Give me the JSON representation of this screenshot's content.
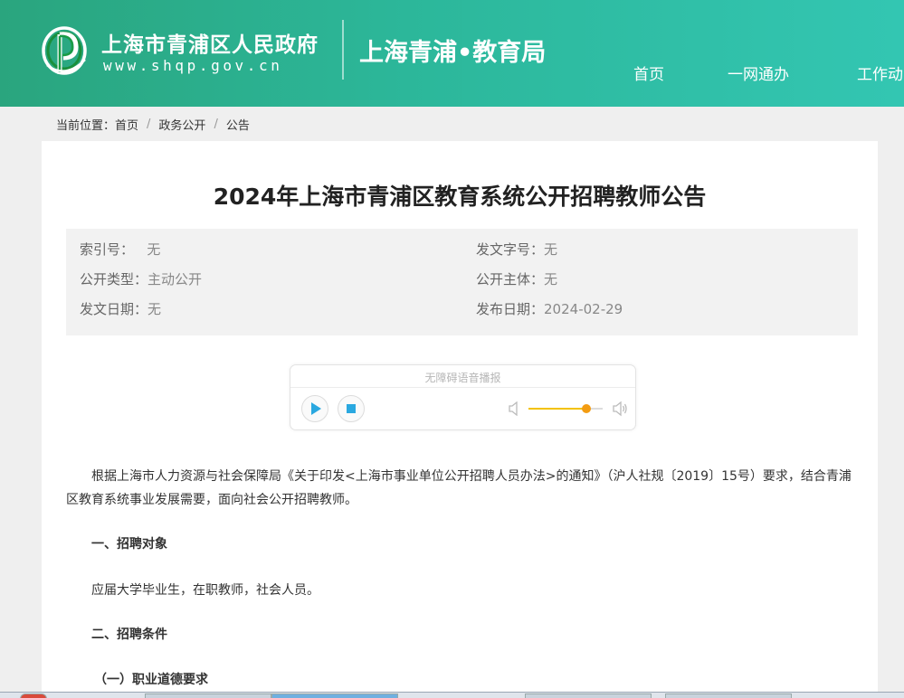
{
  "header": {
    "gov_name": "上海市青浦区人民政府",
    "gov_url": "www.shqp.gov.cn",
    "dept_name": "上海青浦•教育局",
    "nav": [
      "首页",
      "一网通办",
      "工作动"
    ]
  },
  "breadcrumb": {
    "label": "当前位置：",
    "items": [
      "首页",
      "政务公开",
      "公告"
    ]
  },
  "article": {
    "title": "2024年上海市青浦区教育系统公开招聘教师公告",
    "meta": {
      "index_label": "索引号：",
      "index_value": "无",
      "doc_no_label": "发文字号：",
      "doc_no_value": "无",
      "type_label": "公开类型：",
      "type_value": "主动公开",
      "subject_label": "公开主体：",
      "subject_value": "无",
      "doc_date_label": "发文日期：",
      "doc_date_value": "无",
      "pub_date_label": "发布日期：",
      "pub_date_value": "2024-02-29"
    },
    "player": {
      "title": "无障碍语音播报",
      "volume": 0.78
    },
    "paragraphs": {
      "p1": "根据上海市人力资源与社会保障局《关于印发<上海市事业单位公开招聘人员办法>的通知》（沪人社规〔2019〕15号）要求，结合青浦区教育系统事业发展需要，面向社会公开招聘教师。",
      "h1": "一、招聘对象",
      "p2": "应届大学毕业生，在职教师，社会人员。",
      "h2": "二、招聘条件",
      "h3": "（一）职业道德要求"
    }
  },
  "colors": {
    "header_start": "#2aa57e",
    "header_end": "#33c6b2",
    "play_icon": "#2aa8e0",
    "volume_fill": "#f3c200",
    "volume_knob": "#f39c12"
  }
}
